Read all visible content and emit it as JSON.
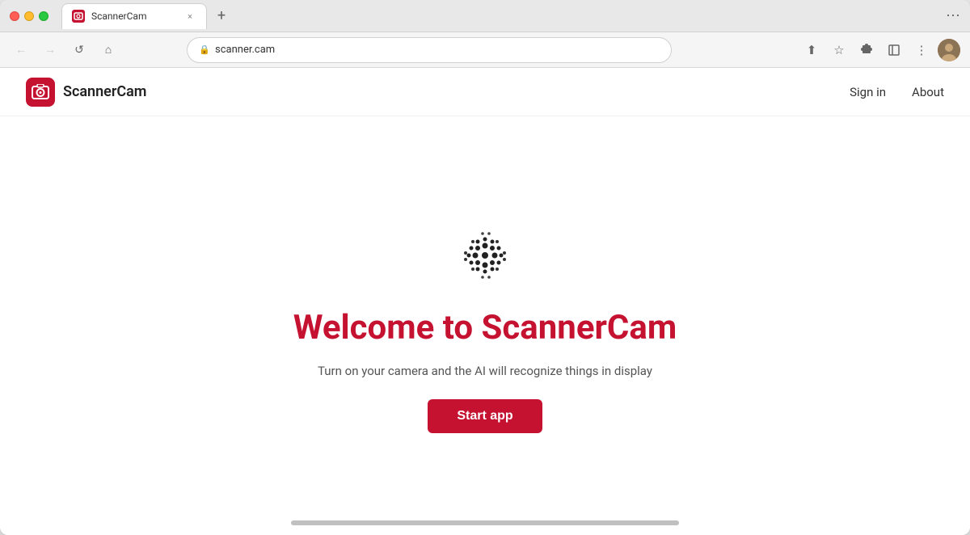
{
  "browser": {
    "tab": {
      "title": "ScannerCam",
      "url": "scanner.cam",
      "close_label": "×",
      "new_tab_label": "+"
    },
    "nav": {
      "back_icon": "←",
      "forward_icon": "→",
      "refresh_icon": "↺",
      "home_icon": "⌂",
      "share_icon": "⬆",
      "star_icon": "☆",
      "extension_icon": "🧩",
      "menu_icon": "⋮"
    }
  },
  "site": {
    "logo": {
      "text": "ScannerCam"
    },
    "nav": {
      "sign_in": "Sign in",
      "about": "About"
    },
    "hero": {
      "title": "Welcome to ScannerCam",
      "subtitle": "Turn on your camera and the AI will recognize things in display",
      "cta": "Start app"
    }
  },
  "colors": {
    "brand_red": "#c41230",
    "brand_dark_red": "#a50e27"
  }
}
